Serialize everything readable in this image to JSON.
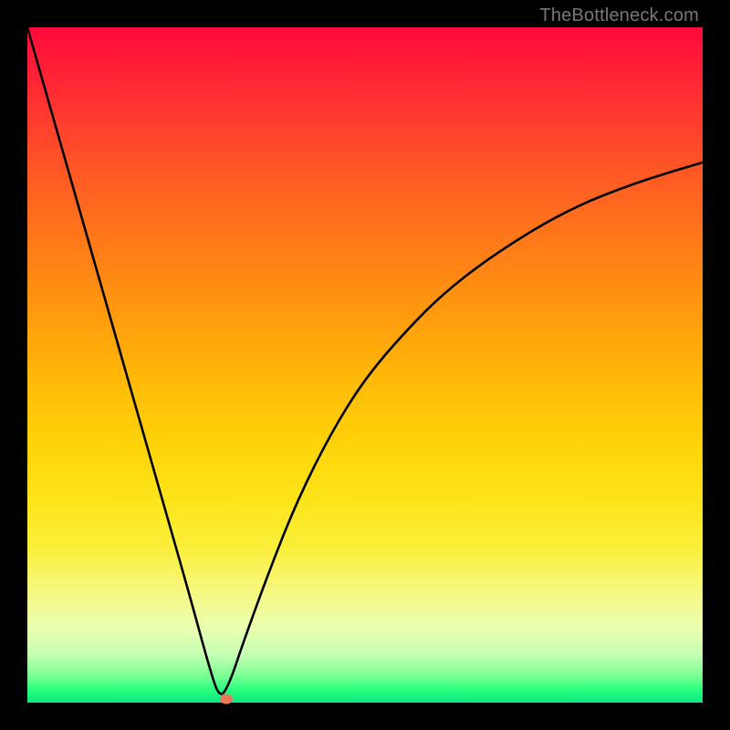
{
  "watermark": "TheBottleneck.com",
  "chart_data": {
    "type": "line",
    "title": "",
    "xlabel": "",
    "ylabel": "",
    "xlim": [
      0,
      100
    ],
    "ylim": [
      0,
      100
    ],
    "grid": false,
    "legend": false,
    "series": [
      {
        "name": "bottleneck-curve",
        "x": [
          0,
          4,
          8,
          12,
          16,
          20,
          24,
          27,
          28.5,
          30,
          32,
          36,
          40,
          45,
          50,
          56,
          62,
          70,
          80,
          90,
          100
        ],
        "y": [
          100,
          86,
          72,
          58,
          44,
          30,
          16,
          5,
          0.5,
          3,
          9,
          20,
          30,
          40,
          48,
          55,
          61,
          67,
          73,
          77,
          80
        ]
      }
    ],
    "marker": {
      "x": 29.5,
      "y": 0.6,
      "color": "#e67a5c"
    },
    "gradient": {
      "top_color": "#ff0a3a",
      "bottom_color": "#09e77f"
    }
  }
}
